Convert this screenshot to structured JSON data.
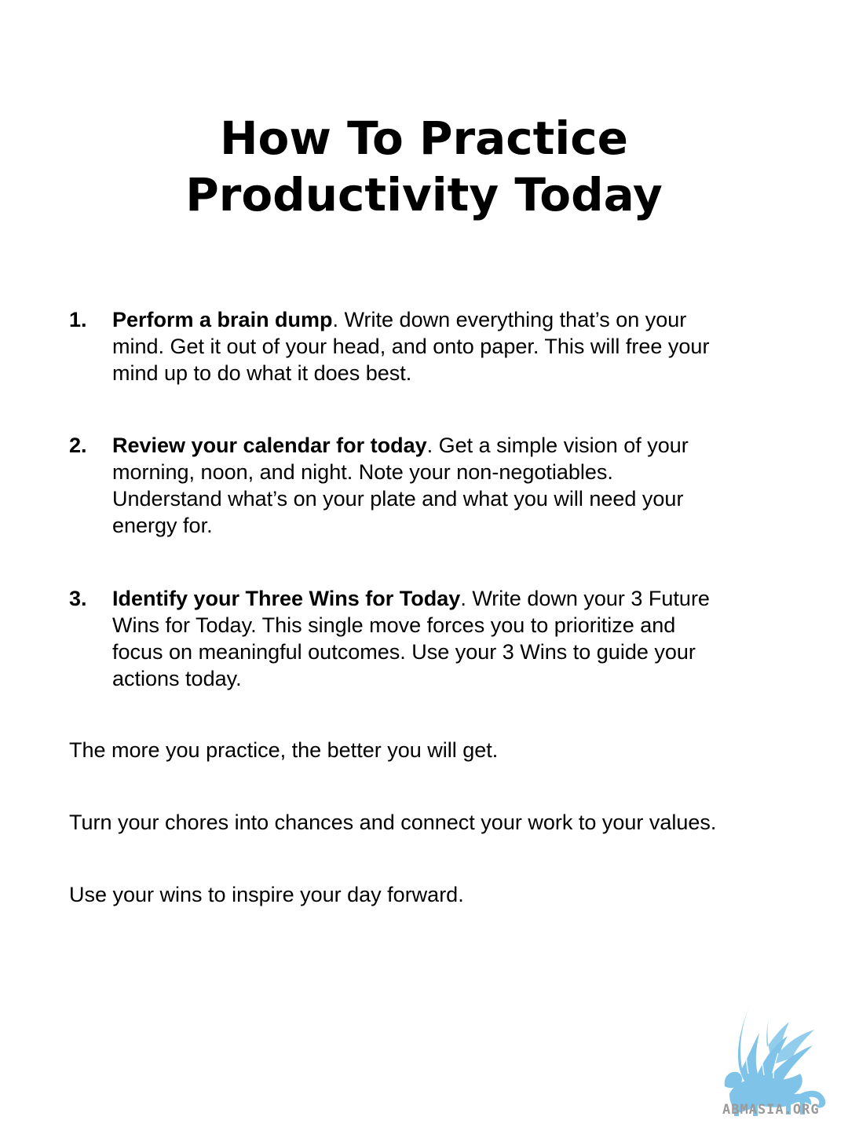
{
  "title": {
    "line1": "How To Practice",
    "line2": "Productivity Today"
  },
  "steps": [
    {
      "number": "1.",
      "lead": "Perform a brain dump",
      "lines": [
        ".  Write down everything that’s on your",
        "mind.  Get it out of your head, and onto paper.  This will free your",
        "mind up to do what it does best."
      ]
    },
    {
      "number": "2.",
      "lead": "Review your calendar for today",
      "lines": [
        ".   Get a simple vision of your",
        "morning, noon, and night.  Note your non-negotiables.",
        "Understand what’s on your plate and what you will need your",
        "energy for."
      ]
    },
    {
      "number": "3.",
      "lead": "Identify your Three Wins for Today",
      "lines": [
        ".    Write down your 3 Future",
        "Wins for Today.   This single move forces you to prioritize and",
        "focus on meaningful outcomes.  Use your 3 Wins to guide your",
        "actions today."
      ]
    }
  ],
  "closing": [
    "The more you practice, the better you will get.",
    "Turn your chores into chances and connect your work to your values.",
    "Use your wins to inspire your day forward."
  ],
  "logo": {
    "icon": "griffin-logo-icon",
    "text": "ABMASIA.ORG",
    "color": "#7fc4e8"
  }
}
